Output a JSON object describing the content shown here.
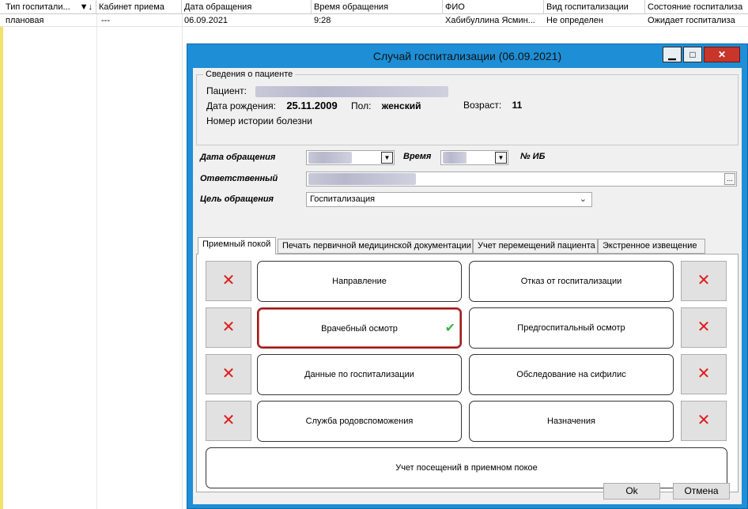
{
  "grid": {
    "columns": [
      "Тип госпитали...",
      "Кабинет приема",
      "Дата обращения",
      "Время обращения",
      "ФИО",
      "Вид госпитализации",
      "Состояние госпитализа"
    ],
    "sort_icon": "sort-desc-icon",
    "row": [
      "плановая",
      "---",
      "06.09.2021",
      "9:28",
      "Хабибуллина Ясмин...",
      "Не определен",
      "Ожидает госпитализа"
    ]
  },
  "dialog": {
    "title": "Случай госпитализации (06.09.2021)",
    "window_buttons": {
      "minimize": "▁",
      "maximize": "□",
      "close": "✕"
    },
    "patient": {
      "legend": "Сведения о пациенте",
      "patient_label": "Пациент:",
      "dob_label": "Дата рождения:",
      "dob_value": "25.11.2009",
      "sex_label": "Пол:",
      "sex_value": "женский",
      "age_label": "Возраст:",
      "age_value": "11",
      "history_label": "Номер истории болезни"
    },
    "fields": {
      "date_label": "Дата обращения",
      "time_label": "Время",
      "ib_label": "№ ИБ",
      "responsible_label": "Ответственный",
      "purpose_label": "Цель обращения",
      "purpose_value": "Госпитализация",
      "ellipsis": "..."
    },
    "tabs": [
      "Приемный покой",
      "Печать первичной медицинской документации",
      "Учет перемещений пациента",
      "Экстренное извещение"
    ],
    "buttons": {
      "referral": "Направление",
      "refusal": "Отказ от госпитализации",
      "doctor_exam": "Врачебный осмотр",
      "pre_hosp_exam": "Предгоспитальный осмотр",
      "hosp_data": "Данные по госпитализации",
      "syphilis": "Обследование на сифилис",
      "obstetric": "Служба родовспоможения",
      "prescriptions": "Назначения",
      "visits": "Учет посещений в приемном покое"
    },
    "x_symbol": "✕",
    "check_symbol": "✔",
    "ok": "Ok",
    "cancel": "Отмена"
  },
  "colors": {
    "title_bar": "#1e8fd6",
    "delete_x": "#e01a1a",
    "check": "#3bb34a",
    "selected_border": "#9c1a1a"
  }
}
